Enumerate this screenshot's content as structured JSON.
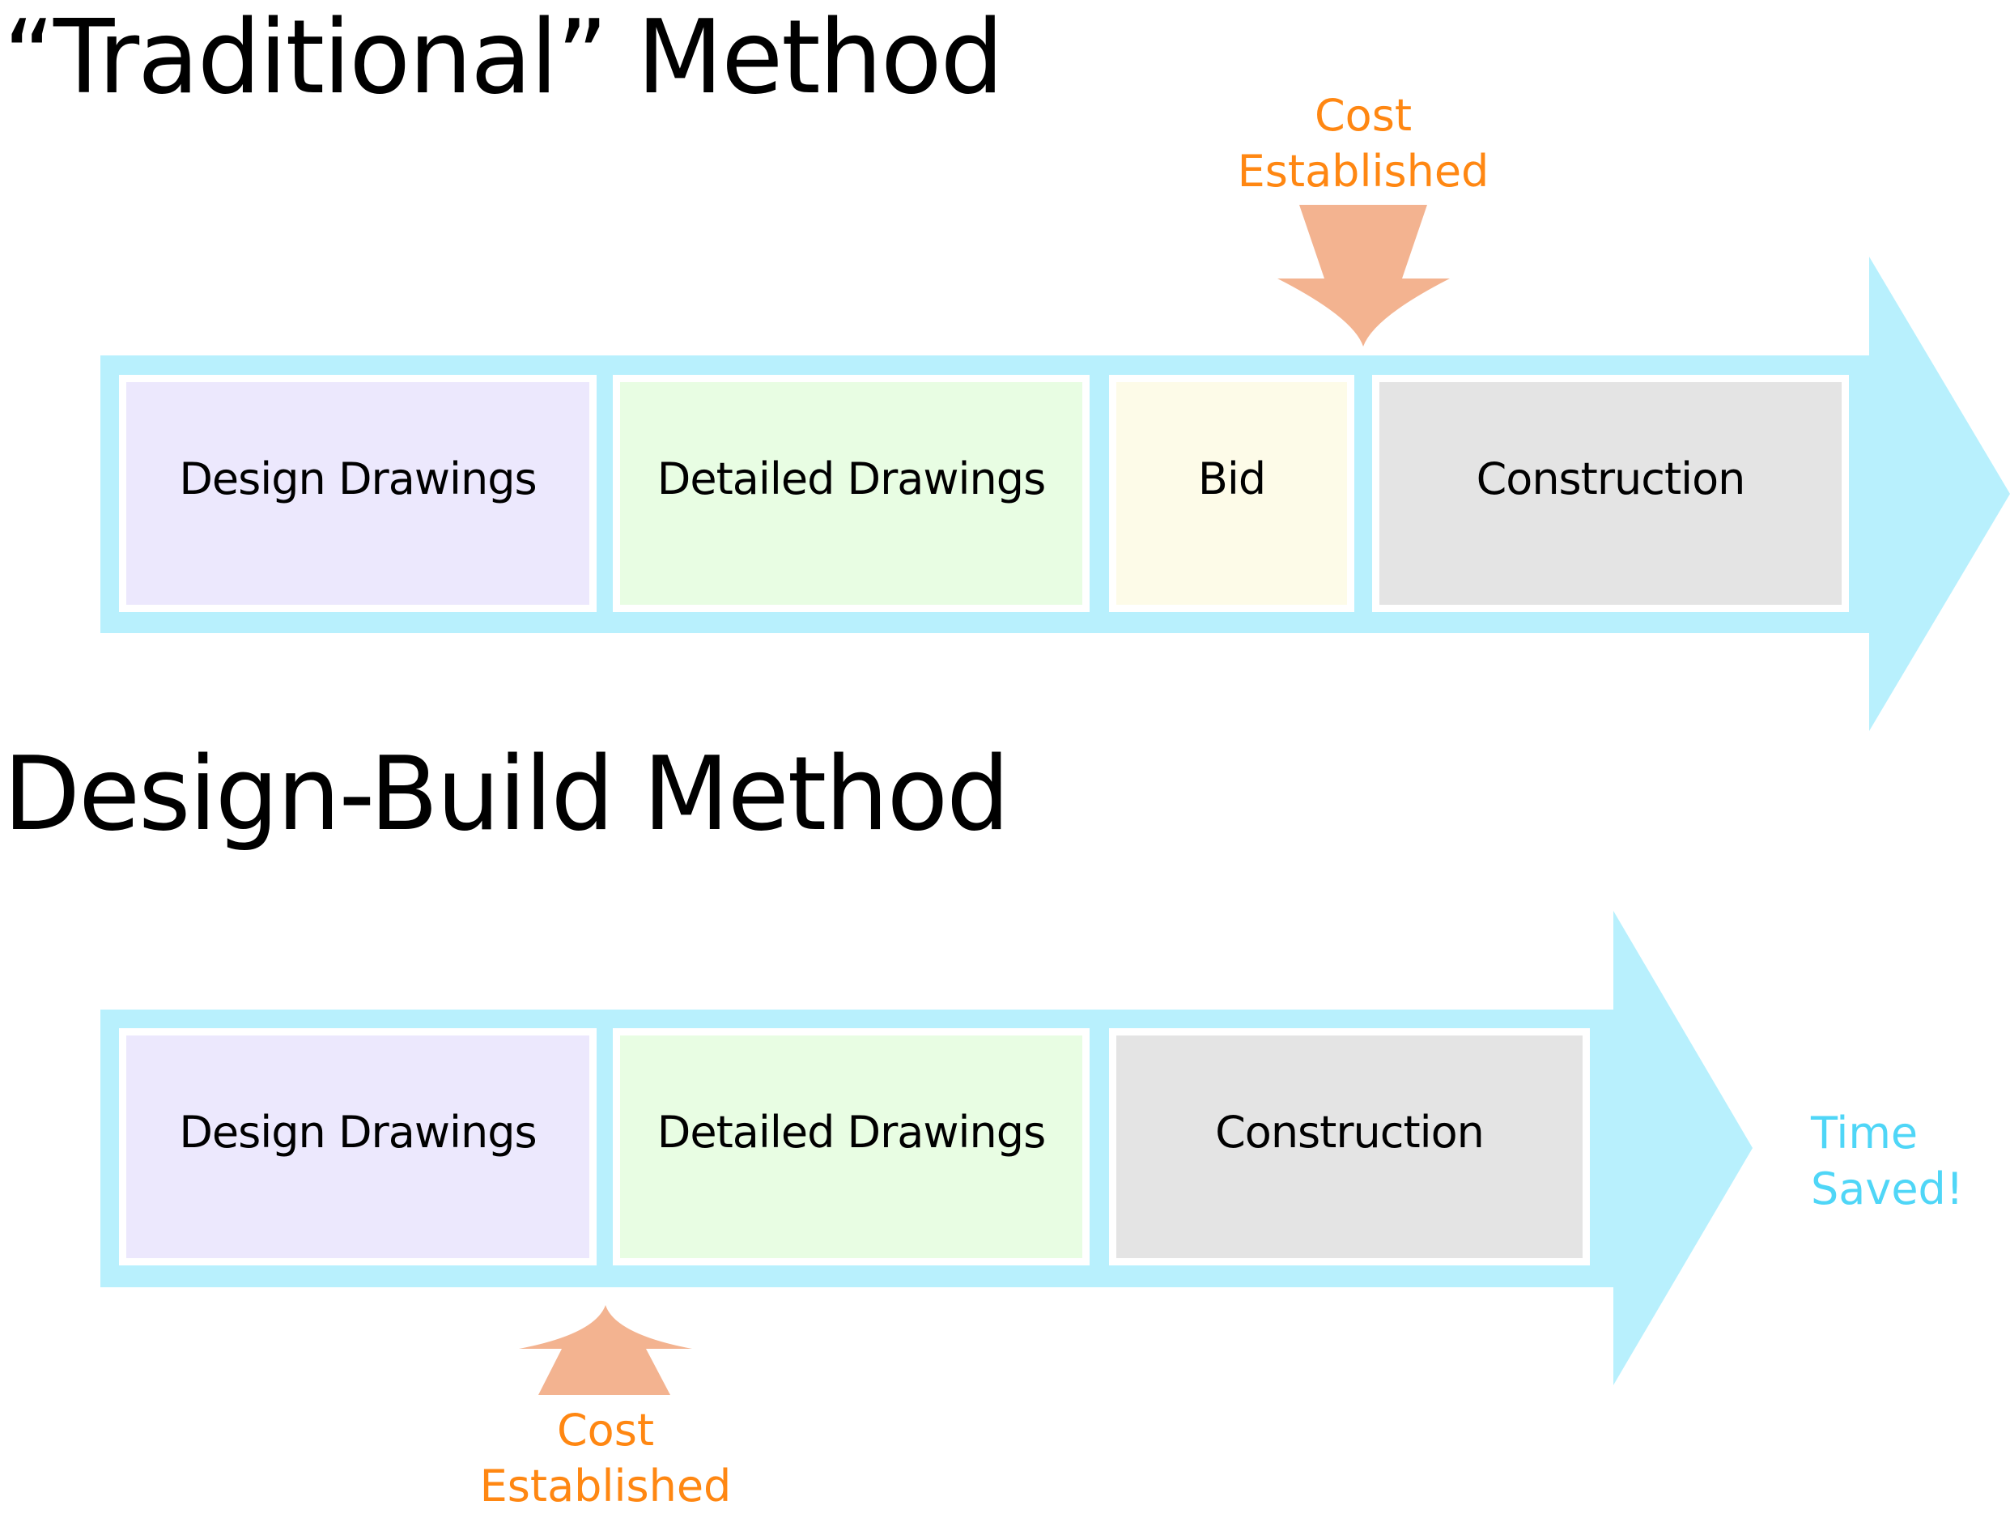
{
  "colors": {
    "timeline_arrow": "#b8f0fd",
    "cost_arrow": "#f3b390",
    "cost_text": "#ff8712",
    "time_saved_text": "#4fd6f7",
    "phase_design": "#ece8fd",
    "phase_detailed": "#e8fde3",
    "phase_bid": "#fdfbe8",
    "phase_construction": "#e4e4e4"
  },
  "traditional": {
    "title": "“Traditional” Method",
    "phases": [
      {
        "label": "Design Drawings"
      },
      {
        "label": "Detailed Drawings"
      },
      {
        "label": "Bid"
      },
      {
        "label": "Construction"
      }
    ],
    "cost_marker": {
      "line1": "Cost",
      "line2": "Established",
      "position": "after Bid, before Construction"
    }
  },
  "design_build": {
    "title": "Design-Build Method",
    "phases": [
      {
        "label": "Design Drawings"
      },
      {
        "label": "Detailed Drawings"
      },
      {
        "label": "Construction"
      }
    ],
    "cost_marker": {
      "line1": "Cost",
      "line2": "Established",
      "position": "after Design Drawings, before Detailed Drawings"
    },
    "callout": {
      "line1": "Time",
      "line2": "Saved!"
    }
  }
}
